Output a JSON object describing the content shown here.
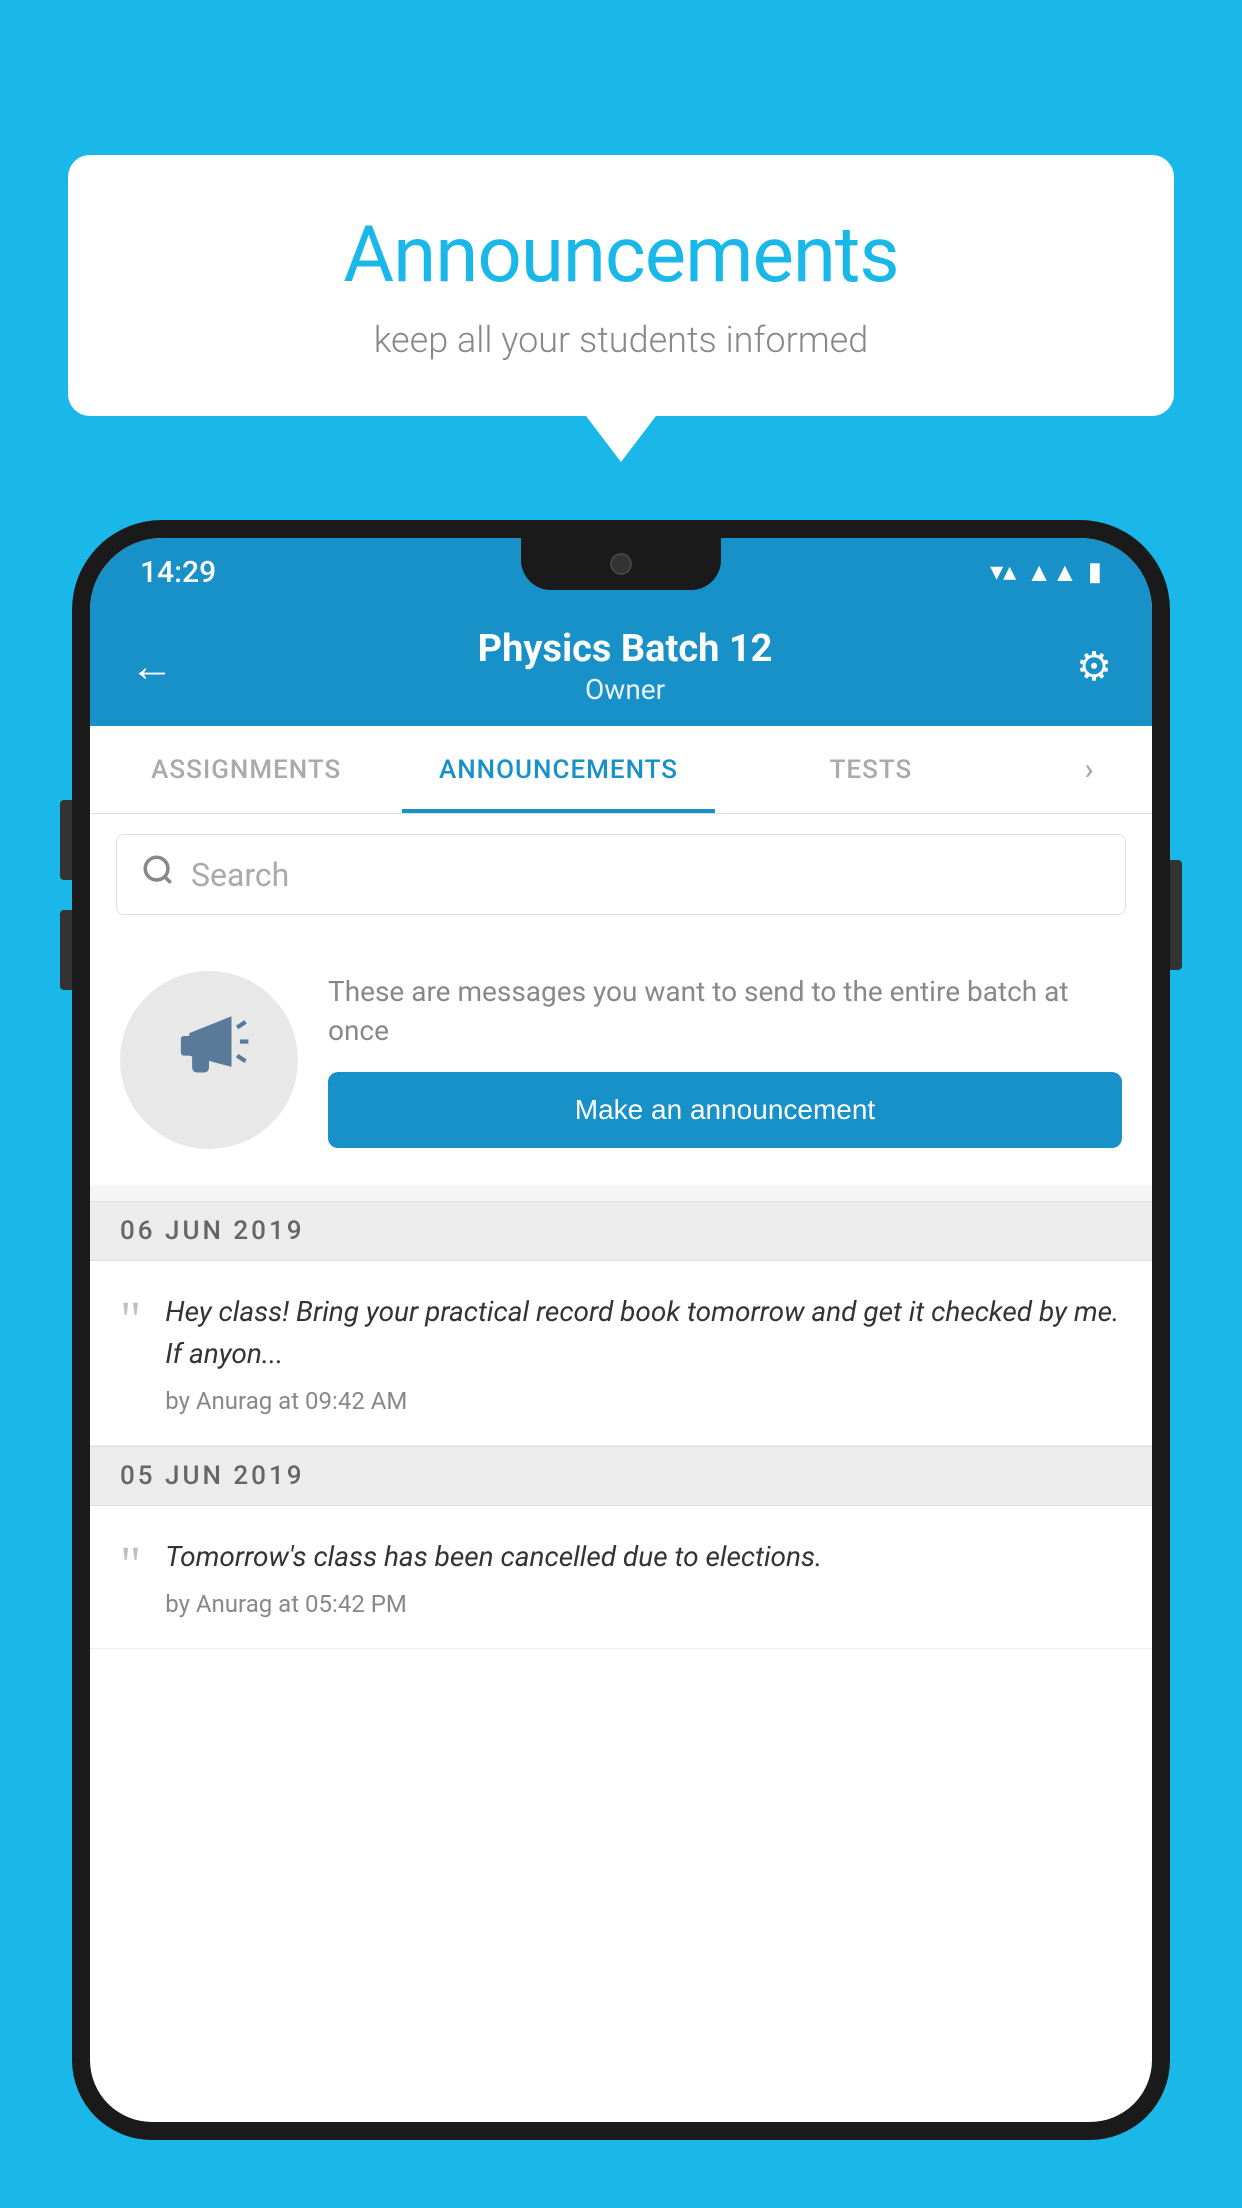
{
  "background_color": "#1ab8e8",
  "speech_bubble": {
    "title": "Announcements",
    "subtitle": "keep all your students informed"
  },
  "phone": {
    "status_bar": {
      "time": "14:29"
    },
    "app_bar": {
      "back_label": "←",
      "title": "Physics Batch 12",
      "subtitle": "Owner",
      "settings_label": "⚙"
    },
    "tabs": [
      {
        "label": "ASSIGNMENTS",
        "active": false
      },
      {
        "label": "ANNOUNCEMENTS",
        "active": true
      },
      {
        "label": "TESTS",
        "active": false
      }
    ],
    "search": {
      "placeholder": "Search"
    },
    "announcement_cta": {
      "description_text": "These are messages you want to send to the entire batch at once",
      "button_label": "Make an announcement"
    },
    "announcements": [
      {
        "date": "06  JUN  2019",
        "text": "Hey class! Bring your practical record book tomorrow and get it checked by me. If anyon...",
        "meta": "by Anurag at 09:42 AM"
      },
      {
        "date": "05  JUN  2019",
        "text": "Tomorrow's class has been cancelled due to elections.",
        "meta": "by Anurag at 05:42 PM"
      }
    ]
  }
}
